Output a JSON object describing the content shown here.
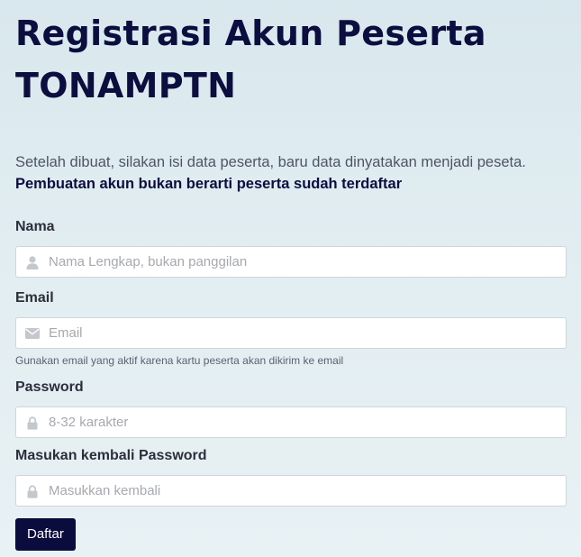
{
  "page": {
    "title": "Registrasi Akun Peserta TONAMPTN",
    "lead": "Setelah dibuat, silakan isi data peserta, baru data dinyatakan menjadi peseta.",
    "lead_strong": "Pembuatan akun bukan berarti peserta sudah terdaftar"
  },
  "form": {
    "nama": {
      "label": "Nama",
      "placeholder": "Nama Lengkap, bukan panggilan",
      "value": "",
      "icon": "user-icon"
    },
    "email": {
      "label": "Email",
      "placeholder": "Email",
      "value": "",
      "icon": "envelope-icon",
      "help": "Gunakan email yang aktif karena kartu peserta akan dikirim ke email"
    },
    "password": {
      "label": "Password",
      "placeholder": "8-32 karakter",
      "value": "",
      "icon": "lock-icon"
    },
    "password_confirm": {
      "label": "Masukan kembali Password",
      "placeholder": "Masukkan kembali",
      "value": "",
      "icon": "lock-icon"
    },
    "submit_label": "Daftar"
  },
  "colors": {
    "primary": "#0b0c3e",
    "text_muted": "#4e5562",
    "background": "#dde9ee"
  }
}
